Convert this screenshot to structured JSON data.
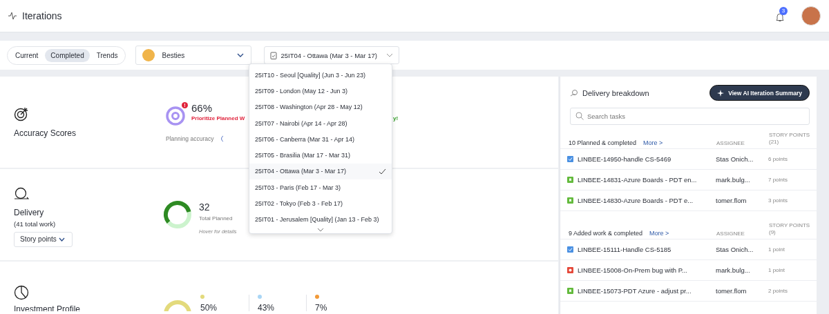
{
  "header": {
    "title": "Iterations",
    "notification_count": "3"
  },
  "view_tabs": [
    {
      "label": "Current",
      "selected": false
    },
    {
      "label": "Completed",
      "selected": true
    },
    {
      "label": "Trends",
      "selected": false
    }
  ],
  "team_select": {
    "value": "Besties"
  },
  "iteration_select": {
    "value": "25IT04 - Ottawa (Mar 3 - Mar 17)",
    "expanded": true,
    "options": [
      {
        "label": "25IT10 - Seoul [Quality] (Jun 3 - Jun 23)",
        "selected": false
      },
      {
        "label": "25IT09 - London (May 12 - Jun 3)",
        "selected": false
      },
      {
        "label": "25IT08 - Washington (Apr 28 - May 12)",
        "selected": false
      },
      {
        "label": "25IT07 - Nairobi (Apr 14 - Apr 28)",
        "selected": false
      },
      {
        "label": "25IT06 - Canberra (Mar 31 - Apr 14)",
        "selected": false
      },
      {
        "label": "25IT05 - Brasilia (Mar 17 - Mar 31)",
        "selected": false
      },
      {
        "label": "25IT04 - Ottawa (Mar 3 - Mar 17)",
        "selected": true
      },
      {
        "label": "25IT03 - Paris (Feb 17 - Mar 3)",
        "selected": false
      },
      {
        "label": "25IT02 - Tokyo (Feb 3 - Feb 17)",
        "selected": false
      },
      {
        "label": "25IT01 - Jerusalem [Quality] (Jan 13 - Feb 3)",
        "selected": false
      }
    ]
  },
  "accuracy": {
    "title": "Accuracy Scores",
    "badge": "!",
    "value": "66%",
    "warning": "Prioritize Planned W",
    "success": "y!",
    "caption": "Planning accuracy"
  },
  "delivery": {
    "title": "Delivery",
    "subtitle": "(41 total work)",
    "unit_select": "Story points",
    "value": "32",
    "value_label": "Total Planned",
    "hint": "Hover for details"
  },
  "investment": {
    "title": "Investment Profile",
    "legend": [
      {
        "value": "50%",
        "color": "#e3da7c"
      },
      {
        "value": "43%",
        "color": "#a9d6f5"
      },
      {
        "value": "7%",
        "color": "#f29a38"
      }
    ]
  },
  "breakdown": {
    "title": "Delivery breakdown",
    "summary_button": "View AI Iteration Summary",
    "search": {
      "placeholder": "Search tasks"
    },
    "groups": [
      {
        "title": "10 Planned & completed",
        "more": "More >",
        "assignee_header": "ASSIGNEE",
        "points_header": "STORY POINTS",
        "points_total": "(21)",
        "rows": [
          {
            "kind": "task",
            "name": "LINBEE-14950-handle CS-5469",
            "assignee": "Stas Onich...",
            "points": "6 points"
          },
          {
            "kind": "story",
            "name": "LINBEE-14831-Azure Boards - PDT en...",
            "assignee": "mark.bulg...",
            "points": "7 points"
          },
          {
            "kind": "story",
            "name": "LINBEE-14830-Azure Boards - PDT e...",
            "assignee": "tomer.flom",
            "points": "3 points"
          }
        ]
      },
      {
        "title": "9 Added work & completed",
        "more": "More >",
        "assignee_header": "ASSIGNEE",
        "points_header": "STORY POINTS",
        "points_total": "(9)",
        "rows": [
          {
            "kind": "task",
            "name": "LINBEE-15111-Handle CS-5185",
            "assignee": "Stas Onich...",
            "points": "1 point"
          },
          {
            "kind": "bug",
            "name": "LINBEE-15008-On-Prem bug with P...",
            "assignee": "mark.bulg...",
            "points": "1 point"
          },
          {
            "kind": "story",
            "name": "LINBEE-15073-PDT Azure - adjust pr...",
            "assignee": "tomer.flom",
            "points": "2 points"
          }
        ]
      }
    ]
  }
}
